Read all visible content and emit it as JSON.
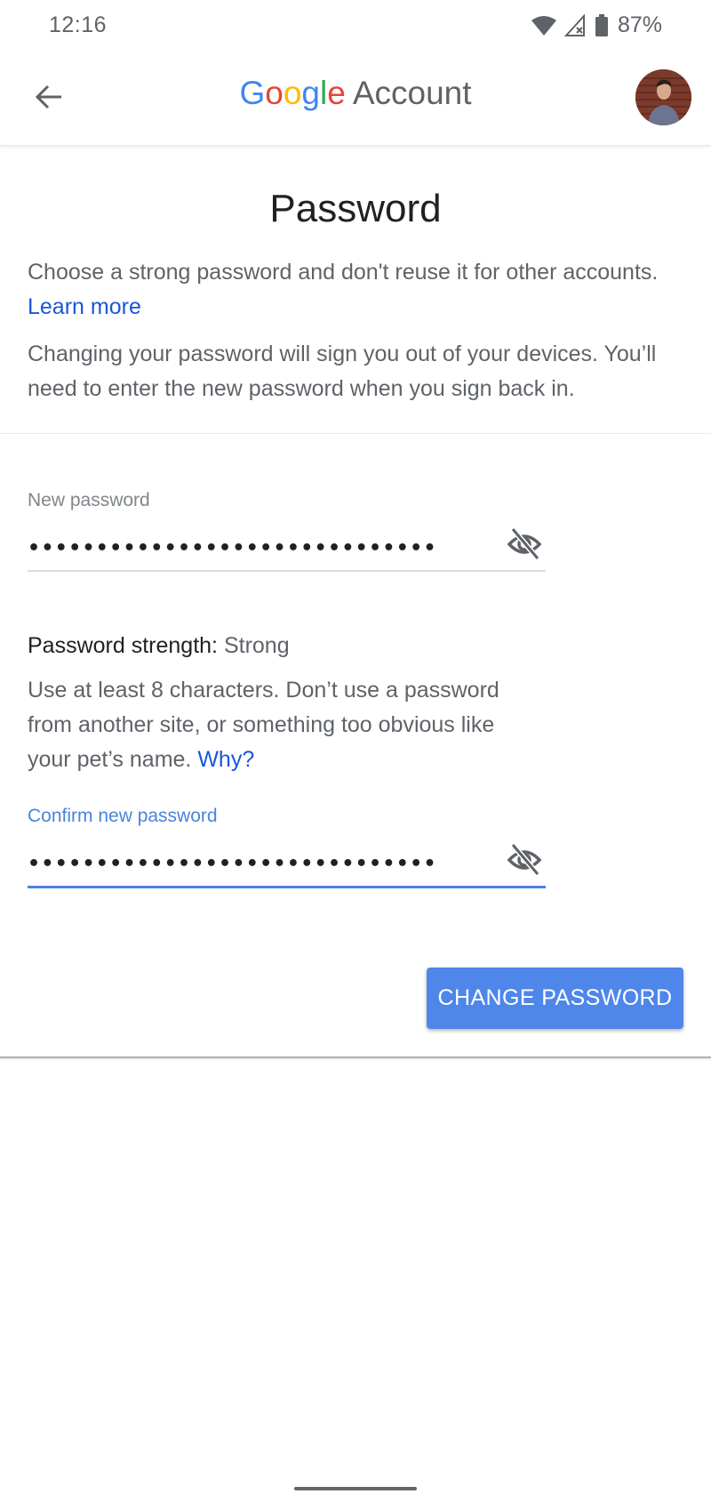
{
  "status_bar": {
    "time": "12:16",
    "icons": [
      "wifi-icon",
      "no-signal-icon",
      "battery-icon"
    ],
    "battery_percent": "87%"
  },
  "app_bar": {
    "back_icon": "arrow-back-icon",
    "brand": {
      "letters": [
        {
          "char": "G",
          "color": "#4285f4"
        },
        {
          "char": "o",
          "color": "#ea4335"
        },
        {
          "char": "o",
          "color": "#fbbc05"
        },
        {
          "char": "g",
          "color": "#4285f4"
        },
        {
          "char": "l",
          "color": "#34a853"
        },
        {
          "char": "e",
          "color": "#ea4335"
        }
      ],
      "suffix": "Account"
    },
    "avatar_icon": "profile-avatar"
  },
  "page": {
    "title": "Password",
    "intro": {
      "text": "Choose a strong password and don't reuse it for other accounts.",
      "link": "Learn more"
    },
    "notice": "Changing your password will sign you out of your devices. You’ll need to enter the new password when you sign back in."
  },
  "form": {
    "new_password": {
      "label": "New password",
      "value": "••••••••••••••••••••••••••••••",
      "toggle_icon": "visibility-off-icon"
    },
    "strength": {
      "label": "Password strength:",
      "value": "Strong"
    },
    "hint": {
      "text": "Use at least 8 characters. Don’t use a password from another site, or something too obvious like your pet’s name.",
      "link": "Why?"
    },
    "confirm_password": {
      "label": "Confirm new password",
      "value": "••••••••••••••••••••••••••••••",
      "toggle_icon": "visibility-off-icon",
      "focused": true
    },
    "submit_label": "CHANGE PASSWORD"
  },
  "colors": {
    "accent": "#4f86ea",
    "link": "#1a56db",
    "focus": "#4a84d9"
  }
}
